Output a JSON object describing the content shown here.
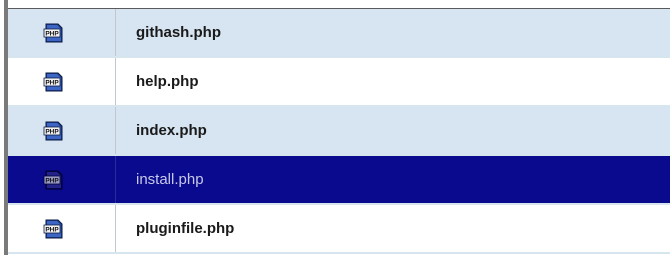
{
  "file_list": {
    "rows": [
      {
        "name": "githash.php",
        "icon": "php-file-icon",
        "selected": false
      },
      {
        "name": "help.php",
        "icon": "php-file-icon",
        "selected": false
      },
      {
        "name": "index.php",
        "icon": "php-file-icon",
        "selected": false
      },
      {
        "name": "install.php",
        "icon": "php-file-icon",
        "selected": true
      },
      {
        "name": "pluginfile.php",
        "icon": "php-file-icon",
        "selected": false
      }
    ]
  },
  "colors": {
    "row_alt": "#d6e5f1",
    "row_plain": "#ffffff",
    "row_selected": "#0a0a8e",
    "selected_text": "#c8c8e8"
  }
}
